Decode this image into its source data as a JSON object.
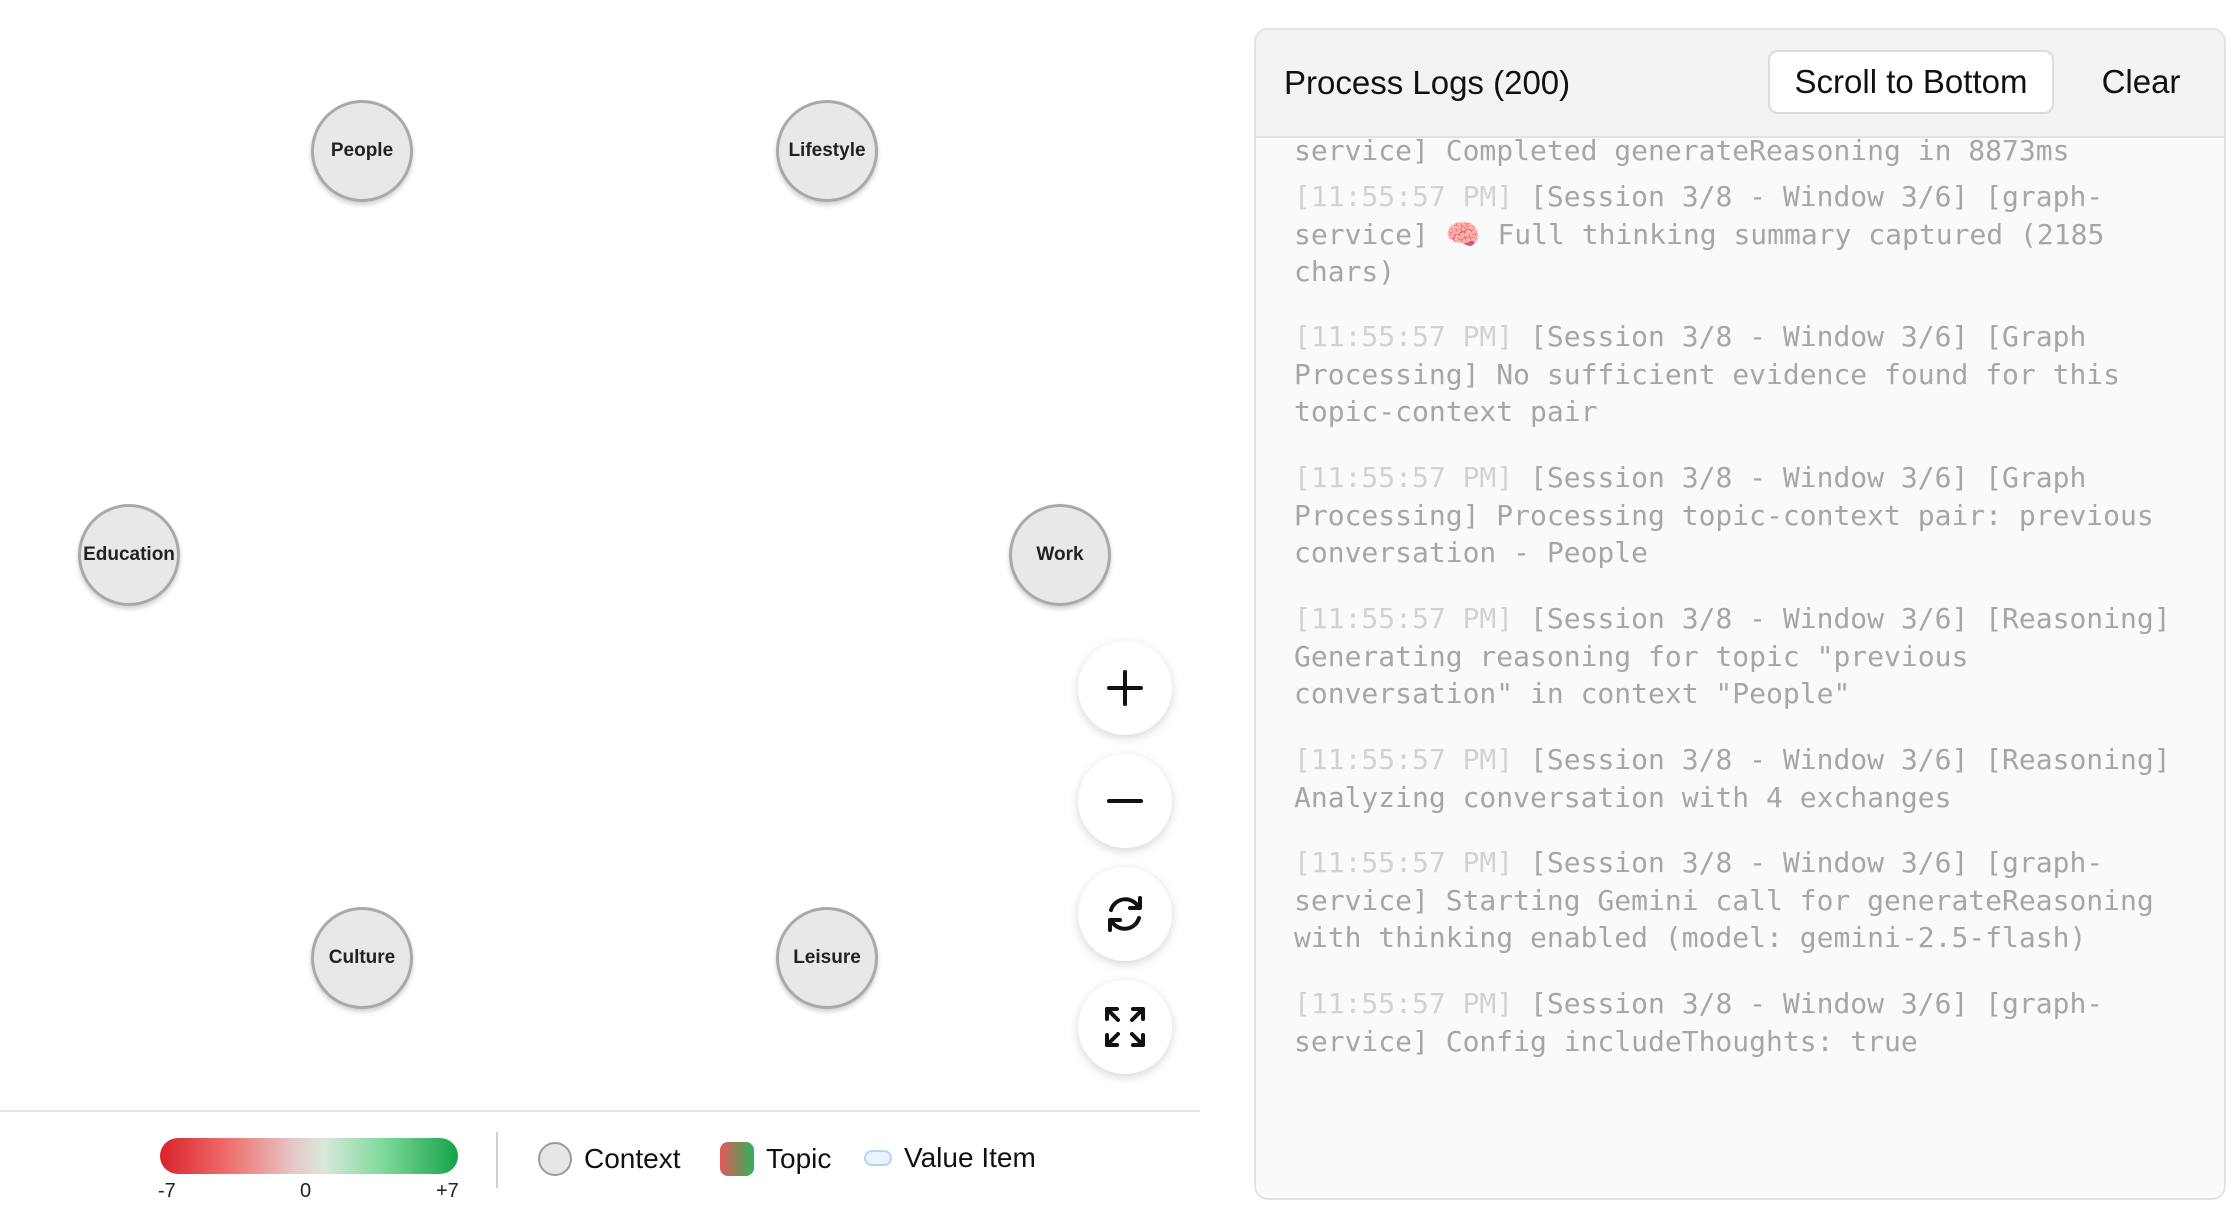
{
  "graph": {
    "nodes": [
      "People",
      "Lifestyle",
      "Education",
      "Work",
      "Culture",
      "Leisure"
    ],
    "controls": {
      "zoom_in_icon": "plus-icon",
      "zoom_out_icon": "minus-icon",
      "reset_icon": "refresh-icon",
      "fit_icon": "expand-icon"
    }
  },
  "legend": {
    "scale_min": "-7",
    "scale_mid": "0",
    "scale_max": "+7",
    "items": [
      "Context",
      "Topic",
      "Value Item"
    ],
    "colors": {
      "negative": "#d9222a",
      "positive": "#14a349"
    }
  },
  "logs": {
    "title": "Process Logs (200)",
    "scroll_button": "Scroll to Bottom",
    "clear_button": "Clear",
    "entries": [
      {
        "ts": "",
        "text": "service] Completed generateReasoning in 8873ms"
      },
      {
        "ts": "[11:55:57 PM]",
        "text": " [Session 3/8 - Window 3/6] [graph-service] 🧠 Full thinking summary captured (2185 chars)"
      },
      {
        "ts": "[11:55:57 PM]",
        "text": " [Session 3/8 - Window 3/6] [Graph Processing] No sufficient evidence found for this topic-context pair"
      },
      {
        "ts": "[11:55:57 PM]",
        "text": " [Session 3/8 - Window 3/6] [Graph Processing] Processing topic-context pair: previous conversation - People"
      },
      {
        "ts": "[11:55:57 PM]",
        "text": " [Session 3/8 - Window 3/6] [Reasoning] Generating reasoning for topic \"previous conversation\" in context \"People\""
      },
      {
        "ts": "[11:55:57 PM]",
        "text": " [Session 3/8 - Window 3/6] [Reasoning] Analyzing conversation with 4 exchanges"
      },
      {
        "ts": "[11:55:57 PM]",
        "text": " [Session 3/8 - Window 3/6] [graph-service] Starting Gemini call for generateReasoning with thinking enabled (model: gemini-2.5-flash)"
      },
      {
        "ts": "[11:55:57 PM]",
        "text": " [Session 3/8 - Window 3/6] [graph-service] Config includeThoughts: true"
      }
    ]
  }
}
